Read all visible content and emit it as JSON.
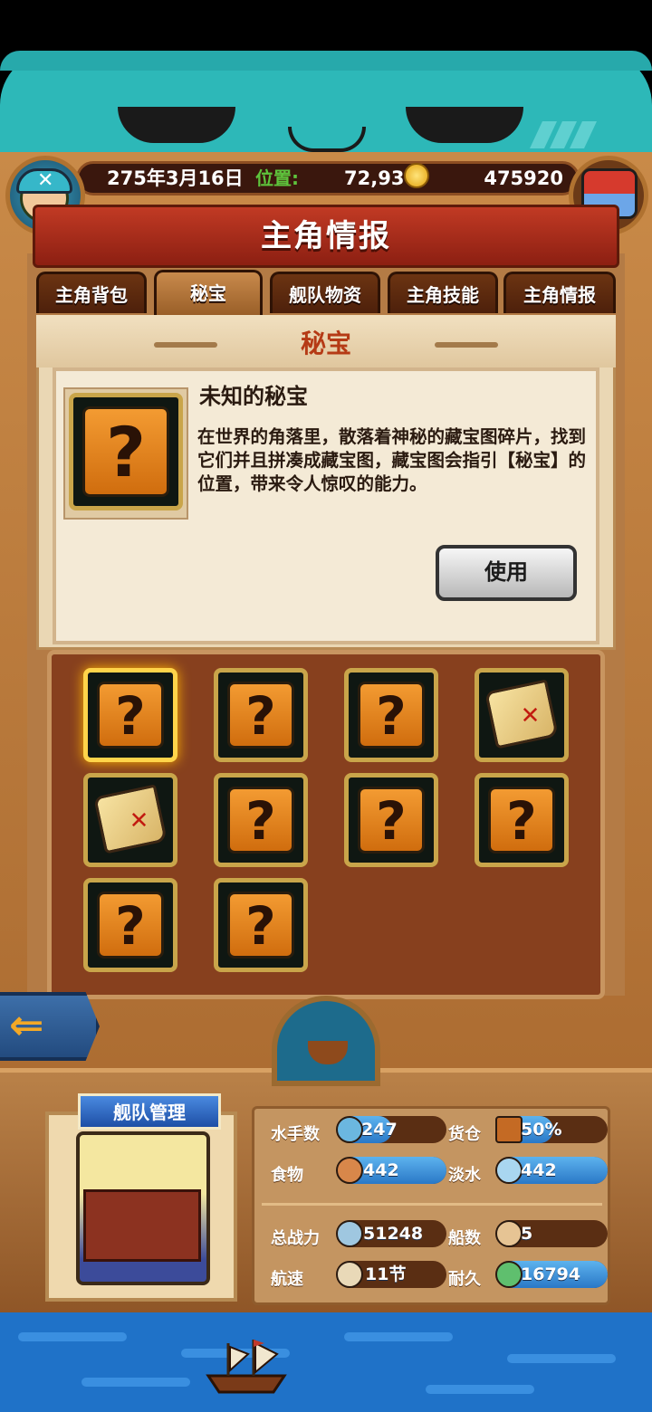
{
  "hud": {
    "date": "275年3月16日",
    "position_label": "位置:",
    "position": "72,93",
    "gold": "475920"
  },
  "title": "主角情报",
  "tabs": [
    {
      "label": "主角背包",
      "active": false
    },
    {
      "label": "秘宝",
      "active": true
    },
    {
      "label": "舰队物资",
      "active": false
    },
    {
      "label": "主角技能",
      "active": false
    },
    {
      "label": "主角情报",
      "active": false
    }
  ],
  "section_title": "秘宝",
  "detail": {
    "name": "未知的秘宝",
    "description": "在世界的角落里，散落着神秘的藏宝图碎片，找到它们并且拼凑成藏宝图，藏宝图会指引【秘宝】的位置，带来令人惊叹的能力。",
    "use_button": "使用",
    "icon": "question-mark-icon"
  },
  "grid": {
    "items": [
      {
        "type": "unknown",
        "selected": true
      },
      {
        "type": "unknown",
        "selected": false
      },
      {
        "type": "unknown",
        "selected": false
      },
      {
        "type": "map",
        "selected": false
      },
      {
        "type": "map",
        "selected": false
      },
      {
        "type": "unknown",
        "selected": false
      },
      {
        "type": "unknown",
        "selected": false
      },
      {
        "type": "unknown",
        "selected": false
      },
      {
        "type": "unknown",
        "selected": false
      },
      {
        "type": "unknown",
        "selected": false
      }
    ]
  },
  "fleet": {
    "label": "舰队管理",
    "stats": {
      "sailors": {
        "label": "水手数",
        "value": "247",
        "icon": "sailor-icon"
      },
      "cargo": {
        "label": "货仓",
        "value": "50%",
        "icon": "crate-icon"
      },
      "food": {
        "label": "食物",
        "value": "442",
        "icon": "meat-icon"
      },
      "water": {
        "label": "淡水",
        "value": "442",
        "icon": "water-icon"
      },
      "power": {
        "label": "总战力",
        "value": "51248",
        "icon": "swords-icon"
      },
      "ships": {
        "label": "船数",
        "value": "5",
        "icon": "ship-icon"
      },
      "speed": {
        "label": "航速",
        "value": "11节",
        "icon": "sail-icon"
      },
      "durability": {
        "label": "耐久",
        "value": "16794",
        "icon": "repair-icon"
      }
    }
  },
  "colors": {
    "accent_red": "#b53a15",
    "bar_blue": "#2a78c7",
    "position_green": "#5ec43c"
  }
}
